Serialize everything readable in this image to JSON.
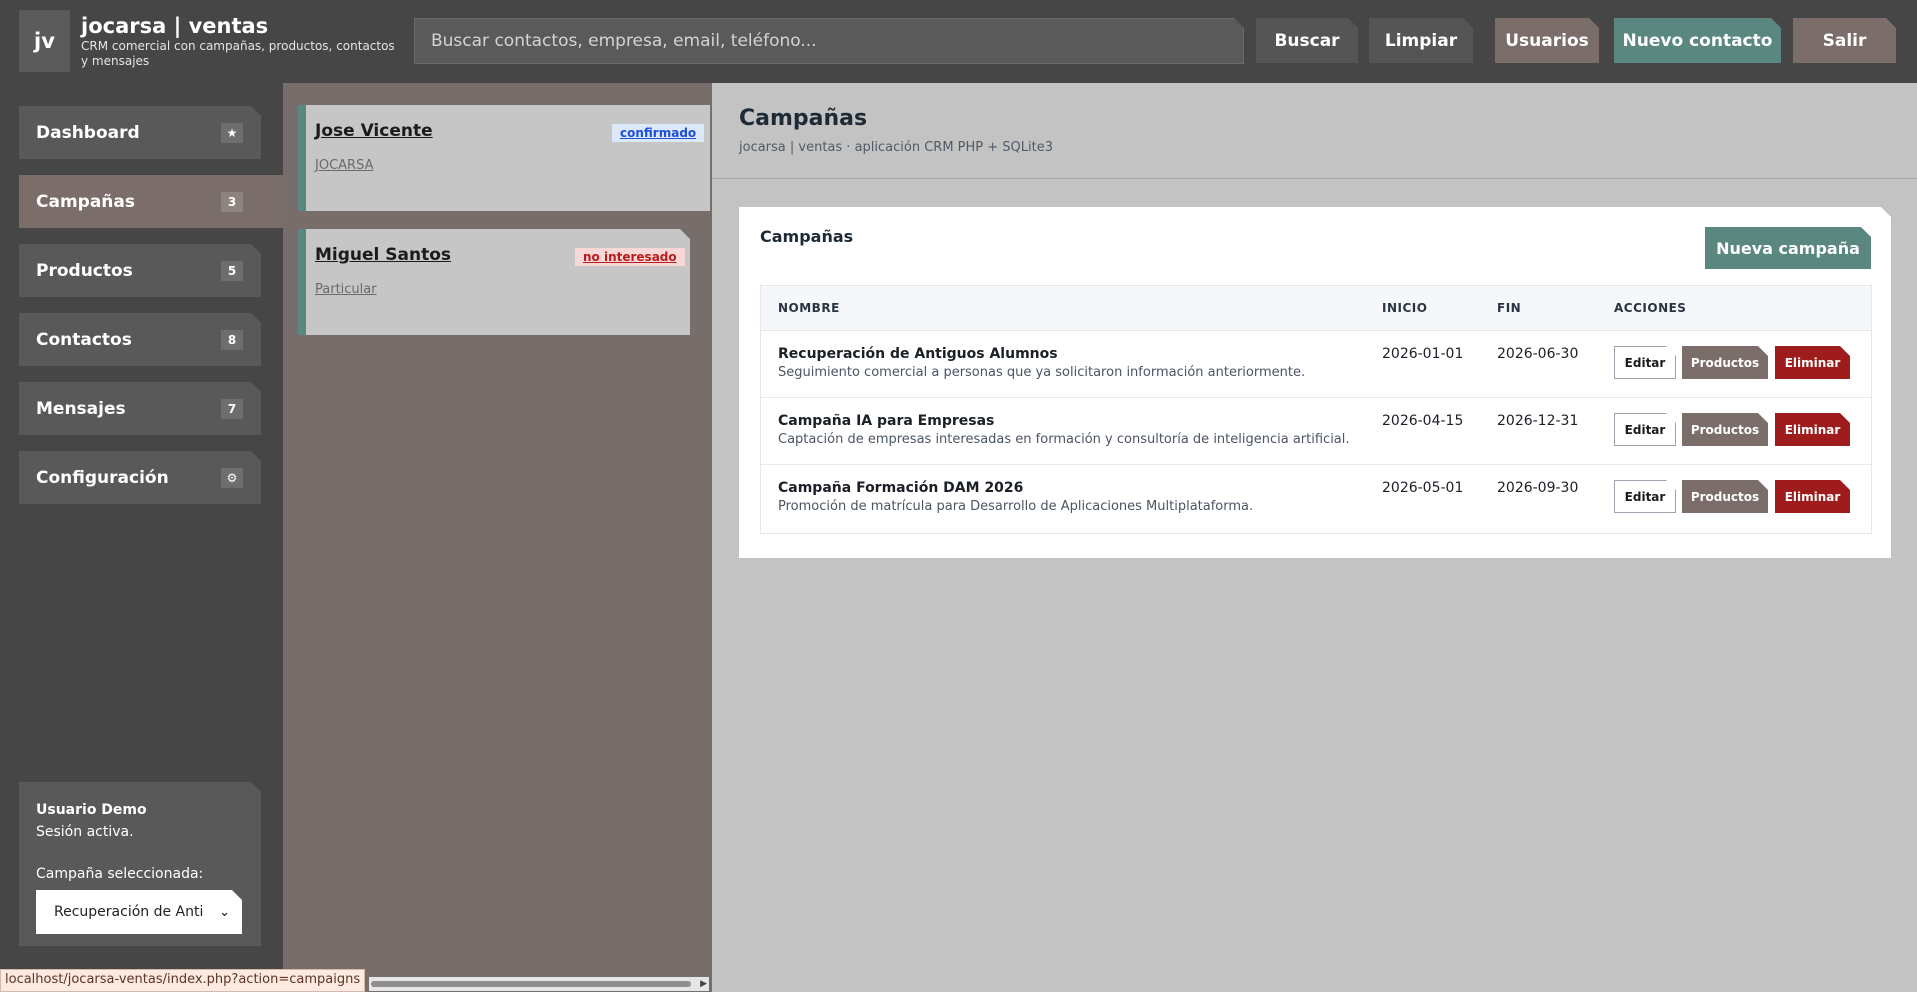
{
  "header": {
    "logo": "jv",
    "title": "jocarsa | ventas",
    "subtitle": "CRM comercial con campañas, productos, contactos y mensajes",
    "search_placeholder": "Buscar contactos, empresa, email, teléfono...",
    "buttons": {
      "search": "Buscar",
      "clear": "Limpiar",
      "users": "Usuarios",
      "new_contact": "Nuevo contacto",
      "logout": "Salir"
    }
  },
  "sidebar": {
    "items": [
      {
        "label": "Dashboard",
        "badge": "★"
      },
      {
        "label": "Campañas",
        "badge": "3"
      },
      {
        "label": "Productos",
        "badge": "5"
      },
      {
        "label": "Contactos",
        "badge": "8"
      },
      {
        "label": "Mensajes",
        "badge": "7"
      },
      {
        "label": "Configuración",
        "badge": "⚙"
      }
    ],
    "user": {
      "name": "Usuario Demo",
      "status": "Sesión activa.",
      "campaign_label": "Campaña seleccionada:",
      "campaign_value": "Recuperación de Antiguos Alumnos"
    }
  },
  "contacts": [
    {
      "name": "Jose Vicente",
      "company": "JOCARSA",
      "status": "confirmado"
    },
    {
      "name": "Miguel Santos",
      "company": "Particular",
      "status": "no interesado"
    }
  ],
  "main": {
    "title": "Campañas",
    "subtitle": "jocarsa | ventas · aplicación CRM PHP + SQLite3",
    "panel": {
      "title": "Campañas",
      "new_button": "Nueva campaña",
      "columns": {
        "name": "NOMBRE",
        "start": "INICIO",
        "end": "FIN",
        "actions": "ACCIONES"
      },
      "rows": [
        {
          "name": "Recuperación de Antiguos Alumnos",
          "desc": "Seguimiento comercial a personas que ya solicitaron información anteriormente.",
          "start": "2026-01-01",
          "end": "2026-06-30"
        },
        {
          "name": "Campaña IA para Empresas",
          "desc": "Captación de empresas interesadas en formación y consultoría de inteligencia artificial.",
          "start": "2026-04-15",
          "end": "2026-12-31"
        },
        {
          "name": "Campaña Formación DAM 2026",
          "desc": "Promoción de matrícula para Desarrollo de Aplicaciones Multiplataforma.",
          "start": "2026-05-01",
          "end": "2026-09-30"
        }
      ],
      "actions": {
        "edit": "Editar",
        "products": "Productos",
        "delete": "Eliminar"
      }
    }
  },
  "statusbar": "localhost/jocarsa-ventas/index.php?action=campaigns",
  "colors": {
    "header_bg": "#464646",
    "accent_teal": "#5a8880",
    "accent_brown": "#7b6d6a",
    "danger": "#9f1c1c"
  }
}
